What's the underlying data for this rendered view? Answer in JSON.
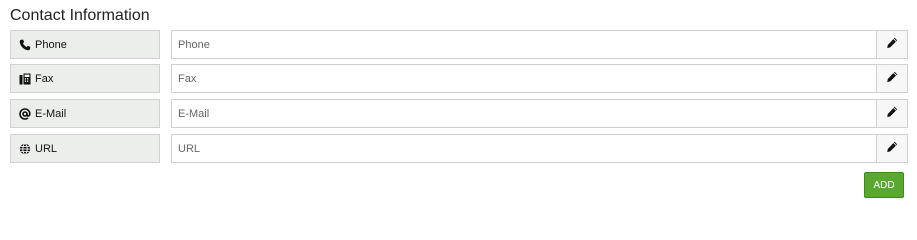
{
  "section": {
    "title": "Contact Information"
  },
  "fields": [
    {
      "label": "Phone",
      "placeholder": "Phone",
      "value": "",
      "icon": "phone-icon"
    },
    {
      "label": "Fax",
      "placeholder": "Fax",
      "value": "",
      "icon": "fax-icon"
    },
    {
      "label": "E-Mail",
      "placeholder": "E-Mail",
      "value": "",
      "icon": "at-icon"
    },
    {
      "label": "URL",
      "placeholder": "URL",
      "value": "",
      "icon": "globe-icon"
    }
  ],
  "actions": {
    "add_label": "ADD"
  },
  "colors": {
    "add_button": "#5aa731",
    "label_bg": "#eceeec"
  }
}
